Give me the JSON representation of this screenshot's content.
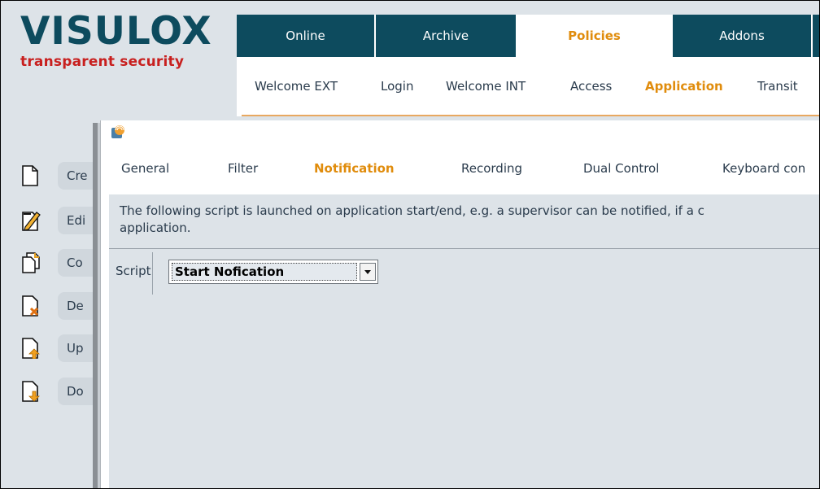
{
  "brand": {
    "name": "VISULOX",
    "tagline": "transparent security",
    "colors": {
      "brand_dark": "#0d4b5e",
      "brand_red": "#c8201f",
      "accent_orange": "#e08c0c"
    }
  },
  "top_nav": {
    "tabs": [
      {
        "label": "Online",
        "active": false
      },
      {
        "label": "Archive",
        "active": false
      },
      {
        "label": "Policies",
        "active": true
      },
      {
        "label": "Addons",
        "active": false
      }
    ]
  },
  "sub_nav": {
    "items": [
      {
        "label": "Welcome EXT",
        "active": false
      },
      {
        "label": "Login",
        "active": false
      },
      {
        "label": "Welcome INT",
        "active": false
      },
      {
        "label": "Access",
        "active": false
      },
      {
        "label": "Application",
        "active": true
      },
      {
        "label": "Transit",
        "active": false
      }
    ]
  },
  "sidebar": {
    "items": [
      {
        "label": "Cre",
        "icon": "document-new-icon"
      },
      {
        "label": "Edi",
        "icon": "document-edit-icon"
      },
      {
        "label": "Co",
        "icon": "document-copy-icon"
      },
      {
        "label": "De",
        "icon": "document-delete-icon"
      },
      {
        "label": "Up",
        "icon": "document-upload-icon"
      },
      {
        "label": "Do",
        "icon": "document-download-icon"
      }
    ]
  },
  "dialog": {
    "icon": "app-logo-icon",
    "tabs": [
      {
        "label": "General",
        "active": false
      },
      {
        "label": "Filter",
        "active": false
      },
      {
        "label": "Notification",
        "active": true
      },
      {
        "label": "Recording",
        "active": false
      },
      {
        "label": "Dual Control",
        "active": false
      },
      {
        "label": "Keyboard con",
        "active": false
      }
    ],
    "description_line1": "The following script is launched on application start/end, e.g. a supervisor can be notified, if a c",
    "description_line2": "application.",
    "script_label": "Script",
    "script_selected": "Start Nofication"
  }
}
